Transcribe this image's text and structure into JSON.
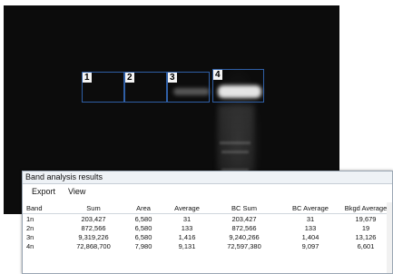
{
  "gel": {
    "bands": [
      {
        "label": "1"
      },
      {
        "label": "2"
      },
      {
        "label": "3"
      },
      {
        "label": "4"
      }
    ]
  },
  "panel": {
    "title": "Band analysis results",
    "menu": [
      "Export",
      "View"
    ],
    "columns": [
      "Band",
      "Sum",
      "Area",
      "Average",
      "BC Sum",
      "BC Average",
      "Bkgd  Average"
    ],
    "rows": [
      [
        "1n",
        "203,427",
        "6,580",
        "31",
        "203,427",
        "31",
        "19,679"
      ],
      [
        "2n",
        "872,566",
        "6,580",
        "133",
        "872,566",
        "133",
        "19"
      ],
      [
        "3n",
        "9,319,226",
        "6,580",
        "1,416",
        "9,240,266",
        "1,404",
        "13,126"
      ],
      [
        "4n",
        "72,868,700",
        "7,980",
        "9,131",
        "72,597,380",
        "9,097",
        "6,601"
      ]
    ]
  }
}
